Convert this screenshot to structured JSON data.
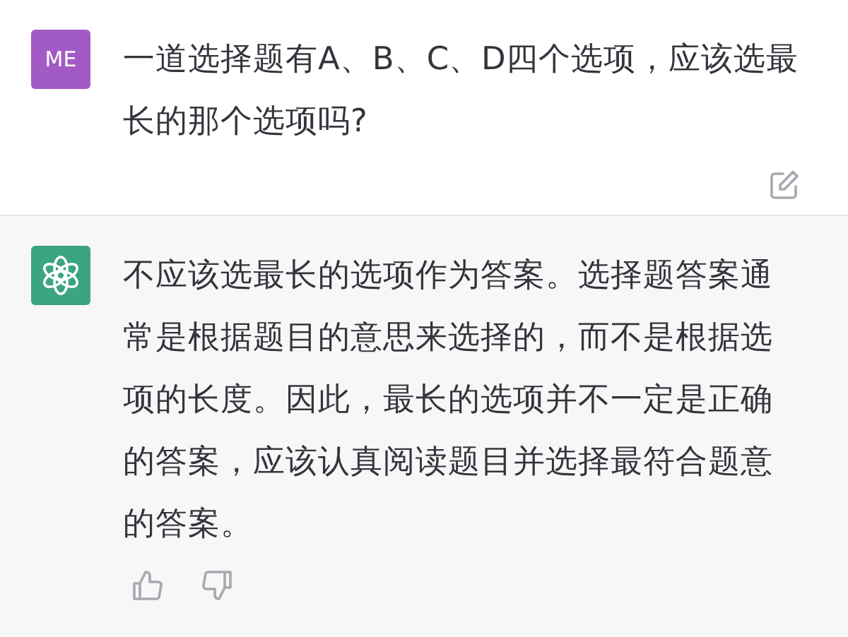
{
  "messages": [
    {
      "kind": "user",
      "avatar": "ME",
      "text": "一道选择题有A、B、C、D四个选项，应该选最长的那个选项吗?"
    },
    {
      "kind": "assistant",
      "text": "不应该选最长的选项作为答案。选择题答案通常是根据题目的意思来选择的，而不是根据选项的长度。因此，最长的选项并不一定是正确的答案，应该认真阅读题目并选择最符合题意的答案。"
    }
  ]
}
